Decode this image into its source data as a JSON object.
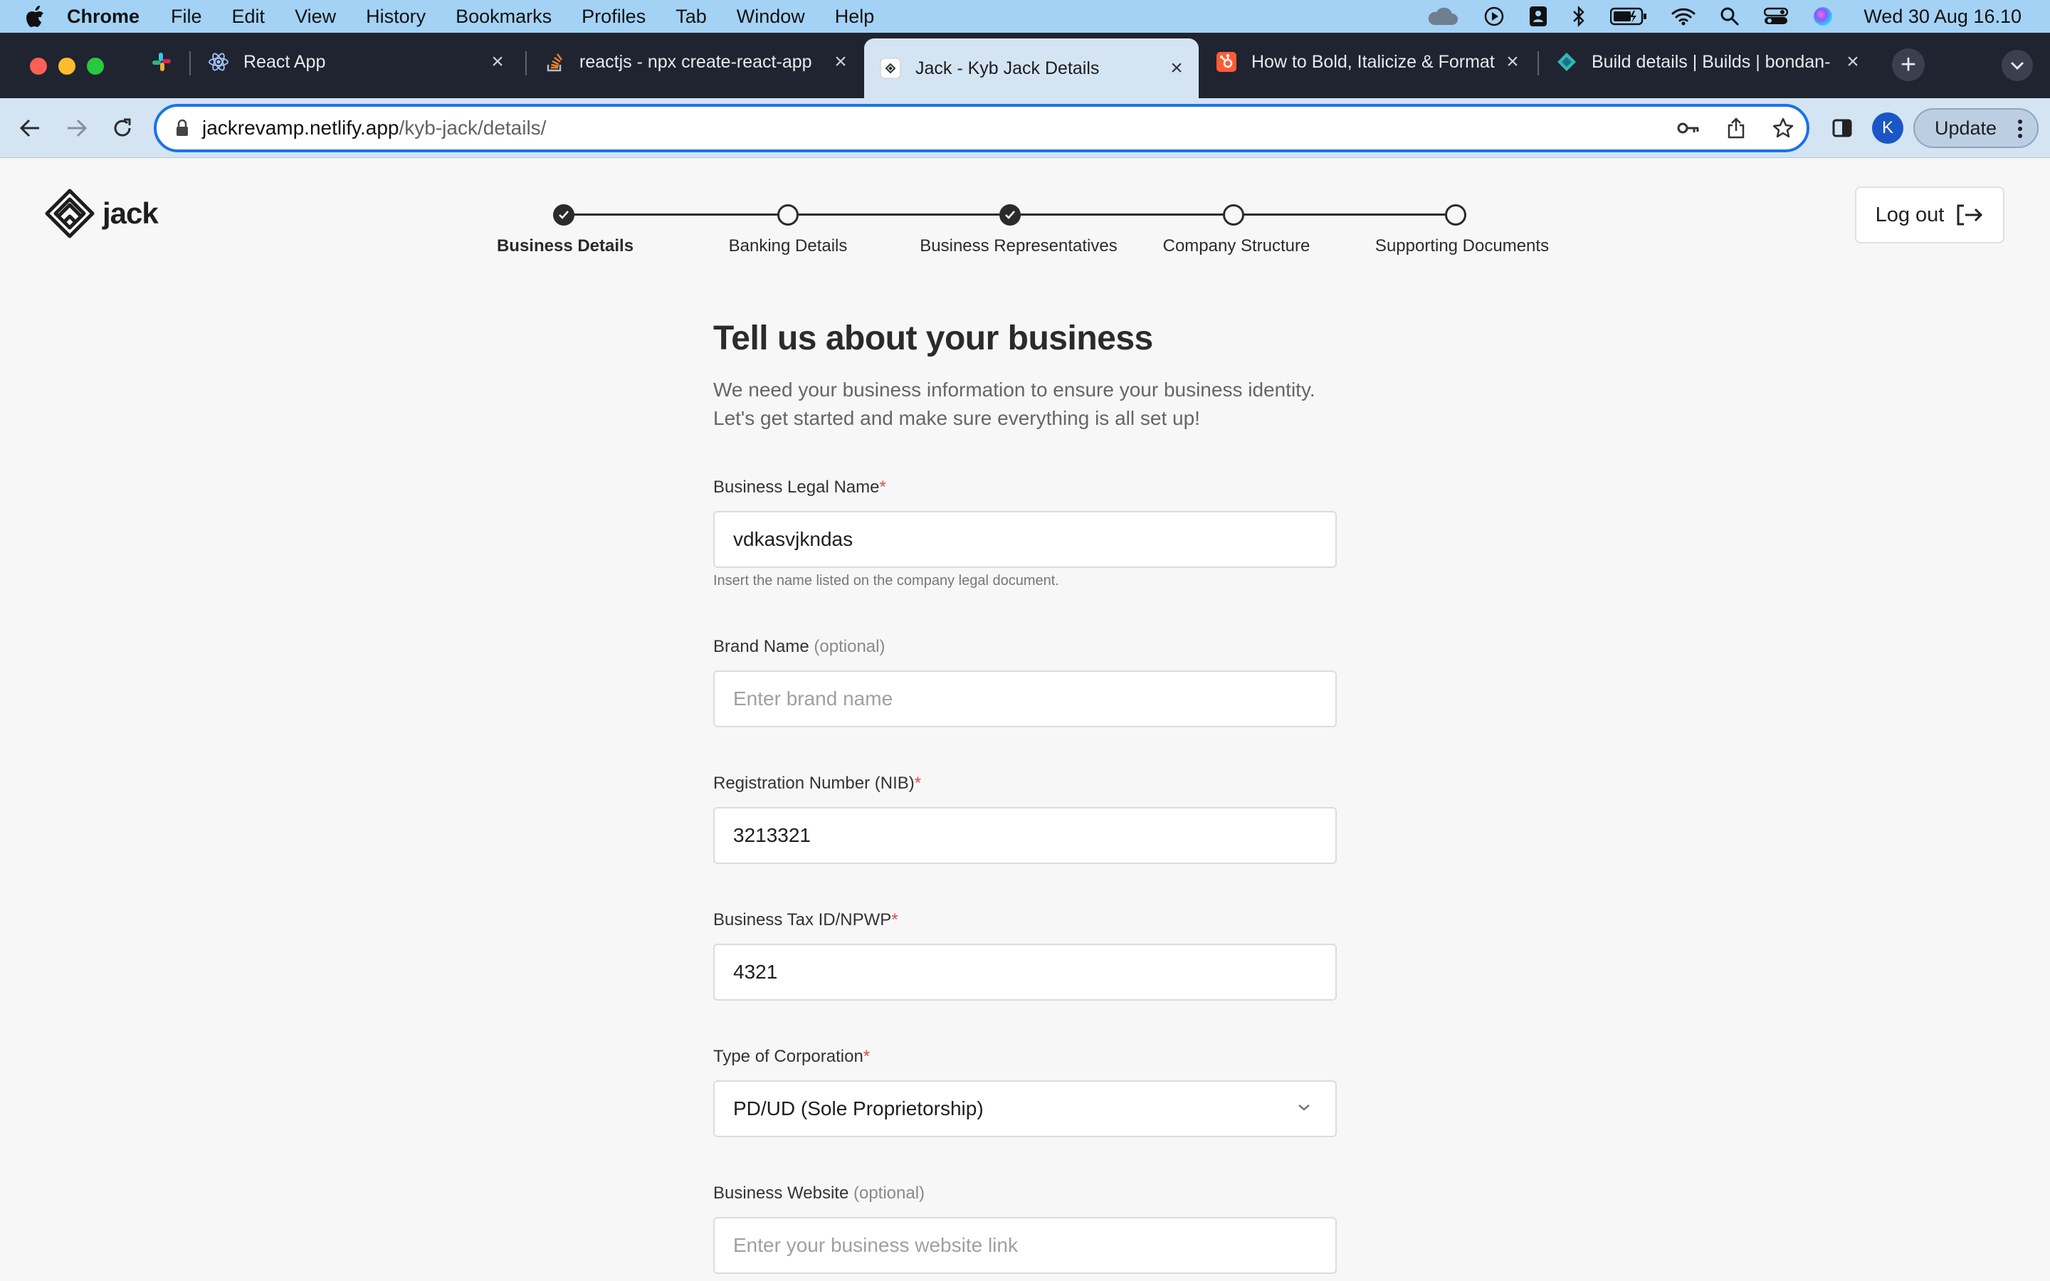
{
  "menubar": {
    "app_name": "Chrome",
    "menus": [
      "File",
      "Edit",
      "View",
      "History",
      "Bookmarks",
      "Profiles",
      "Tab",
      "Window",
      "Help"
    ],
    "clock": "Wed 30 Aug  16.10",
    "status_icons": [
      "cloud-icon",
      "play-icon",
      "contact-icon",
      "bluetooth-icon",
      "battery-icon",
      "wifi-icon",
      "search-icon",
      "control-center-icon",
      "siri-icon"
    ]
  },
  "tabs": [
    {
      "title": "",
      "icon": "slack-icon",
      "pinned": true
    },
    {
      "title": "React App",
      "icon": "react-icon"
    },
    {
      "title": "reactjs - npx create-react-app",
      "icon": "stackoverflow-icon"
    },
    {
      "title": "Jack - Kyb Jack Details",
      "icon": "jack-icon",
      "active": true
    },
    {
      "title": "How to Bold, Italicize & Format",
      "icon": "hubspot-icon"
    },
    {
      "title": "Build details | Builds | bondan-",
      "icon": "netlify-icon"
    }
  ],
  "toolbar": {
    "url_host": "jackrevamp.netlify.app",
    "url_path": "/kyb-jack/details/",
    "profile_initial": "K",
    "update_label": "Update"
  },
  "header": {
    "logo_text": "jack",
    "logout_label": "Log out",
    "steps": [
      {
        "label": "Business Details",
        "status": "done",
        "current": true
      },
      {
        "label": "Banking Details",
        "status": "pending"
      },
      {
        "label": "Business Representatives",
        "status": "done"
      },
      {
        "label": "Company Structure",
        "status": "pending"
      },
      {
        "label": "Supporting Documents",
        "status": "pending"
      }
    ]
  },
  "form": {
    "heading": "Tell us about your business",
    "subtext_line1": "We need your business information to ensure your business identity.",
    "subtext_line2": "Let's get started and make sure everything is all set up!",
    "fields": {
      "legal_name": {
        "label": "Business Legal Name",
        "required_mark": "*",
        "value": "vdkasvjkndas",
        "help": "Insert the name listed on the company legal document."
      },
      "brand_name": {
        "label": "Brand Name",
        "optional_text": "(optional)",
        "placeholder": "Enter brand name"
      },
      "registration": {
        "label": "Registration Number (NIB)",
        "required_mark": "*",
        "value": "3213321"
      },
      "tax_id": {
        "label": "Business Tax ID/NPWP",
        "required_mark": "*",
        "value": "4321"
      },
      "corporation": {
        "label": "Type of Corporation",
        "required_mark": "*",
        "value": "PD/UD (Sole Proprietorship)"
      },
      "website": {
        "label": "Business Website",
        "optional_text": "(optional)",
        "placeholder": "Enter your business website link"
      }
    }
  },
  "colors": {
    "menubar_bg": "#a3d2f5",
    "tabstrip_bg": "#1f2430",
    "toolbar_bg": "#d4e4f3",
    "focus_ring": "#1a73e8",
    "required": "#e5484d",
    "page_bg": "#f7f7f7"
  }
}
